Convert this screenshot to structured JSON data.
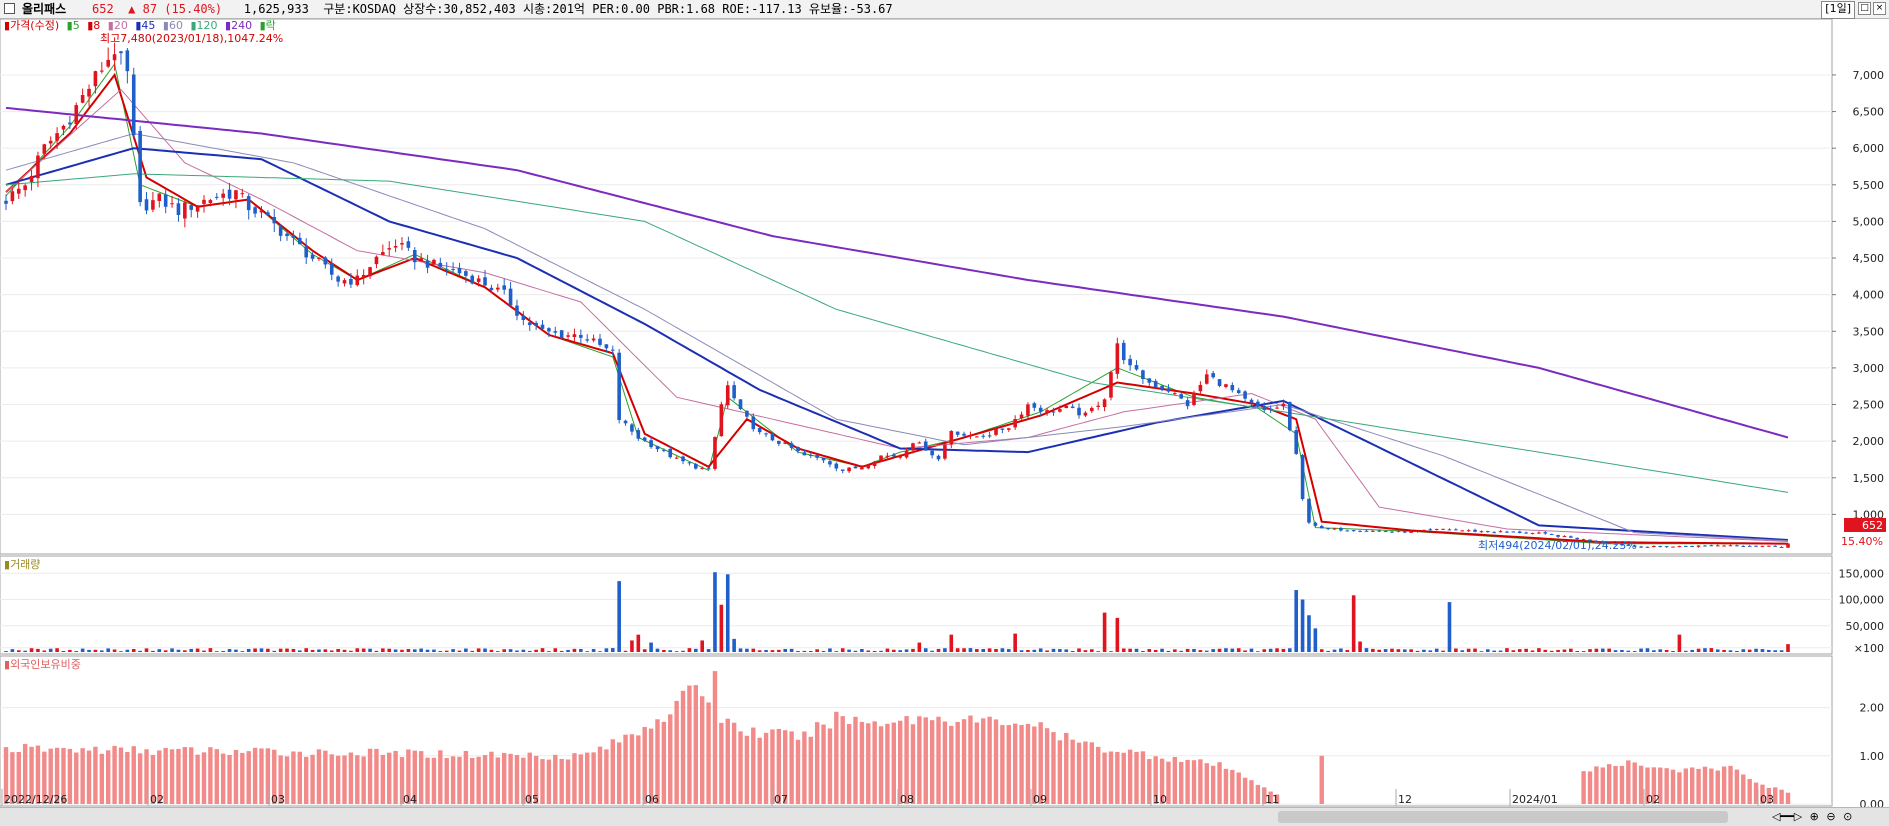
{
  "header": {
    "name": "올리패스",
    "price": "652",
    "arrow": "▲",
    "change": "87",
    "change_pct": "(15.40%)",
    "volume": "1,625,933",
    "info": "구분:KOSDAQ 상장수:30,852,403 시총:201억 PER:0.00 PBR:1.68 ROE:-117.13 유보율:-53.67",
    "period": "[1일]",
    "min_btn": "_",
    "max_btn": "□",
    "close_btn": "×"
  },
  "colors": {
    "up": "#e0141e",
    "down": "#1f5fc9",
    "ma5": "#2ca02c",
    "ma8": "#d40000",
    "ma20": "#c56fa0",
    "ma45": "#1b2fb5",
    "ma60": "#8a8ab8",
    "ma120": "#3aa878",
    "ma240": "#7b2bbf",
    "foreign": "#f28a8a"
  },
  "chart_data": [
    {
      "type": "candlestick",
      "legend_title": "가격(수정)",
      "legend": [
        {
          "name": "5",
          "color": "#2ca02c"
        },
        {
          "name": "8",
          "color": "#d40000"
        },
        {
          "name": "20",
          "color": "#c56fa0"
        },
        {
          "name": "45",
          "color": "#1b2fb5"
        },
        {
          "name": "60",
          "color": "#8a8ab8"
        },
        {
          "name": "120",
          "color": "#3aa878"
        },
        {
          "name": "240",
          "color": "#7b2bbf"
        },
        {
          "name": "락",
          "color": "#2ca02c"
        }
      ],
      "ylim": [
        500,
        7600
      ],
      "yticks": [
        "1,000",
        "1,500",
        "2,000",
        "2,500",
        "3,000",
        "3,500",
        "4,000",
        "4,500",
        "5,000",
        "5,500",
        "6,000",
        "6,500",
        "7,000"
      ],
      "x_labels": [
        "2022/12/26",
        "02",
        "03",
        "04",
        "05",
        "06",
        "07",
        "08",
        "09",
        "10",
        "11",
        "12",
        "2024/01",
        "02",
        "03"
      ],
      "annotations": {
        "high": "최고7,480(2023/01/18),1047.24%",
        "low": "최저494(2024/02/01),24.23%",
        "last_price": "652",
        "last_pct": "15.40%"
      },
      "path_points": [
        [
          0,
          5300
        ],
        [
          3,
          5500
        ],
        [
          6,
          6000
        ],
        [
          9,
          6300
        ],
        [
          12,
          6700
        ],
        [
          15,
          7100
        ],
        [
          17,
          7350
        ],
        [
          19,
          7000
        ],
        [
          20,
          6100
        ],
        [
          21,
          5200
        ],
        [
          24,
          5300
        ],
        [
          27,
          5150
        ],
        [
          30,
          5250
        ],
        [
          33,
          5350
        ],
        [
          36,
          5400
        ],
        [
          38,
          5200
        ],
        [
          40,
          5100
        ],
        [
          44,
          4800
        ],
        [
          48,
          4500
        ],
        [
          52,
          4200
        ],
        [
          55,
          4200
        ],
        [
          58,
          4500
        ],
        [
          61,
          4700
        ],
        [
          64,
          4500
        ],
        [
          67,
          4400
        ],
        [
          71,
          4300
        ],
        [
          75,
          4150
        ],
        [
          78,
          4000
        ],
        [
          81,
          3650
        ],
        [
          84,
          3500
        ],
        [
          87,
          3450
        ],
        [
          90,
          3450
        ],
        [
          93,
          3300
        ],
        [
          95,
          3200
        ],
        [
          96,
          2300
        ],
        [
          99,
          2050
        ],
        [
          102,
          1900
        ],
        [
          105,
          1750
        ],
        [
          108,
          1650
        ],
        [
          110,
          1600
        ],
        [
          112,
          2500
        ],
        [
          113,
          2750
        ],
        [
          115,
          2400
        ],
        [
          118,
          2100
        ],
        [
          122,
          1950
        ],
        [
          125,
          1800
        ],
        [
          128,
          1750
        ],
        [
          131,
          1600
        ],
        [
          134,
          1650
        ],
        [
          137,
          1800
        ],
        [
          140,
          1800
        ],
        [
          142,
          2000
        ],
        [
          144,
          1900
        ],
        [
          146,
          1750
        ],
        [
          148,
          2150
        ],
        [
          151,
          2050
        ],
        [
          154,
          2100
        ],
        [
          157,
          2200
        ],
        [
          160,
          2500
        ],
        [
          163,
          2400
        ],
        [
          166,
          2450
        ],
        [
          169,
          2350
        ],
        [
          172,
          2600
        ],
        [
          174,
          3300
        ],
        [
          176,
          3000
        ],
        [
          179,
          2800
        ],
        [
          182,
          2700
        ],
        [
          185,
          2500
        ],
        [
          188,
          2900
        ],
        [
          191,
          2750
        ],
        [
          194,
          2550
        ],
        [
          197,
          2400
        ],
        [
          200,
          2500
        ],
        [
          202,
          1800
        ],
        [
          203,
          1200
        ],
        [
          204,
          900
        ],
        [
          206,
          800
        ],
        [
          210,
          790
        ],
        [
          215,
          770
        ],
        [
          220,
          760
        ],
        [
          225,
          800
        ],
        [
          230,
          770
        ],
        [
          235,
          760
        ],
        [
          240,
          740
        ],
        [
          245,
          680
        ],
        [
          250,
          620
        ],
        [
          255,
          560
        ],
        [
          260,
          560
        ],
        [
          265,
          570
        ],
        [
          270,
          580
        ],
        [
          275,
          570
        ],
        [
          278,
          560
        ],
        [
          279,
          600
        ]
      ],
      "series": [
        {
          "name": "240",
          "color": "#7b2bbf",
          "points": [
            [
              0,
              6550
            ],
            [
              40,
              6200
            ],
            [
              80,
              5700
            ],
            [
              120,
              4800
            ],
            [
              160,
              4200
            ],
            [
              200,
              3700
            ],
            [
              240,
              3000
            ],
            [
              279,
              2050
            ]
          ]
        },
        {
          "name": "120",
          "color": "#3aa878",
          "points": [
            [
              0,
              5500
            ],
            [
              20,
              5650
            ],
            [
              60,
              5550
            ],
            [
              100,
              5000
            ],
            [
              130,
              3800
            ],
            [
              170,
              2800
            ],
            [
              200,
              2400
            ],
            [
              240,
              1850
            ],
            [
              279,
              1300
            ]
          ]
        },
        {
          "name": "60",
          "color": "#8a8ab8",
          "points": [
            [
              0,
              5700
            ],
            [
              20,
              6200
            ],
            [
              45,
              5800
            ],
            [
              75,
              4900
            ],
            [
              100,
              3800
            ],
            [
              130,
              2300
            ],
            [
              150,
              1950
            ],
            [
              175,
              2200
            ],
            [
              200,
              2500
            ],
            [
              225,
              1800
            ],
            [
              255,
              750
            ],
            [
              279,
              640
            ]
          ]
        },
        {
          "name": "45",
          "color": "#1b2fb5",
          "points": [
            [
              0,
              5500
            ],
            [
              20,
              6000
            ],
            [
              40,
              5850
            ],
            [
              60,
              5000
            ],
            [
              80,
              4500
            ],
            [
              100,
              3600
            ],
            [
              118,
              2700
            ],
            [
              140,
              1900
            ],
            [
              160,
              1850
            ],
            [
              180,
              2250
            ],
            [
              200,
              2550
            ],
            [
              220,
              1700
            ],
            [
              240,
              850
            ],
            [
              279,
              650
            ]
          ]
        },
        {
          "name": "20",
          "color": "#c56fa0",
          "points": [
            [
              0,
              5400
            ],
            [
              18,
              6800
            ],
            [
              28,
              5800
            ],
            [
              40,
              5300
            ],
            [
              55,
              4600
            ],
            [
              75,
              4300
            ],
            [
              90,
              3900
            ],
            [
              105,
              2600
            ],
            [
              120,
              2300
            ],
            [
              140,
              1900
            ],
            [
              160,
              2050
            ],
            [
              175,
              2400
            ],
            [
              195,
              2650
            ],
            [
              205,
              2300
            ],
            [
              215,
              1100
            ],
            [
              235,
              800
            ],
            [
              279,
              630
            ]
          ]
        },
        {
          "name": "8",
          "color": "#d40000",
          "points": [
            [
              0,
              5400
            ],
            [
              10,
              6200
            ],
            [
              17,
              7000
            ],
            [
              22,
              5600
            ],
            [
              30,
              5200
            ],
            [
              38,
              5300
            ],
            [
              48,
              4600
            ],
            [
              55,
              4200
            ],
            [
              64,
              4500
            ],
            [
              75,
              4100
            ],
            [
              85,
              3450
            ],
            [
              95,
              3200
            ],
            [
              100,
              2100
            ],
            [
              110,
              1650
            ],
            [
              116,
              2300
            ],
            [
              124,
              1900
            ],
            [
              134,
              1650
            ],
            [
              140,
              1800
            ],
            [
              150,
              2050
            ],
            [
              162,
              2350
            ],
            [
              174,
              2800
            ],
            [
              186,
              2650
            ],
            [
              196,
              2500
            ],
            [
              202,
              2300
            ],
            [
              206,
              900
            ],
            [
              220,
              780
            ],
            [
              250,
              620
            ],
            [
              279,
              600
            ]
          ]
        },
        {
          "name": "5",
          "color": "#2ca02c",
          "points": [
            [
              0,
              5350
            ],
            [
              10,
              6300
            ],
            [
              17,
              7150
            ],
            [
              21,
              5500
            ],
            [
              30,
              5200
            ],
            [
              38,
              5300
            ],
            [
              48,
              4550
            ],
            [
              55,
              4200
            ],
            [
              64,
              4550
            ],
            [
              75,
              4100
            ],
            [
              85,
              3450
            ],
            [
              95,
              3150
            ],
            [
              99,
              2050
            ],
            [
              110,
              1600
            ],
            [
              113,
              2600
            ],
            [
              124,
              1850
            ],
            [
              134,
              1650
            ],
            [
              140,
              1850
            ],
            [
              150,
              2050
            ],
            [
              162,
              2400
            ],
            [
              174,
              3000
            ],
            [
              186,
              2600
            ],
            [
              196,
              2450
            ],
            [
              202,
              2100
            ],
            [
              205,
              820
            ],
            [
              220,
              770
            ],
            [
              250,
              600
            ],
            [
              279,
              600
            ]
          ]
        }
      ]
    },
    {
      "type": "bar",
      "title": "거래량",
      "ylim": [
        0,
        160000
      ],
      "yticks": [
        "×100",
        "50,000",
        "100,000",
        "150,000"
      ],
      "spikes": [
        {
          "x": 96,
          "value": 135000,
          "dir": "down"
        },
        {
          "x": 98,
          "value": 22000,
          "dir": "up"
        },
        {
          "x": 99,
          "value": 33000,
          "dir": "up"
        },
        {
          "x": 101,
          "value": 18000,
          "dir": "down"
        },
        {
          "x": 109,
          "value": 22000,
          "dir": "up"
        },
        {
          "x": 111,
          "value": 152000,
          "dir": "down"
        },
        {
          "x": 112,
          "value": 90000,
          "dir": "up"
        },
        {
          "x": 113,
          "value": 148000,
          "dir": "down"
        },
        {
          "x": 114,
          "value": 25000,
          "dir": "down"
        },
        {
          "x": 143,
          "value": 18000,
          "dir": "up"
        },
        {
          "x": 148,
          "value": 33000,
          "dir": "up"
        },
        {
          "x": 158,
          "value": 35000,
          "dir": "up"
        },
        {
          "x": 172,
          "value": 75000,
          "dir": "up"
        },
        {
          "x": 174,
          "value": 65000,
          "dir": "up"
        },
        {
          "x": 202,
          "value": 118000,
          "dir": "down"
        },
        {
          "x": 203,
          "value": 100000,
          "dir": "down"
        },
        {
          "x": 204,
          "value": 70000,
          "dir": "down"
        },
        {
          "x": 205,
          "value": 45000,
          "dir": "down"
        },
        {
          "x": 211,
          "value": 108000,
          "dir": "up"
        },
        {
          "x": 212,
          "value": 20000,
          "dir": "up"
        },
        {
          "x": 226,
          "value": 95000,
          "dir": "down"
        },
        {
          "x": 262,
          "value": 33000,
          "dir": "up"
        },
        {
          "x": 279,
          "value": 15000,
          "dir": "up"
        }
      ]
    },
    {
      "type": "bar",
      "title": "외국인보유비중",
      "ylim": [
        0,
        2.8
      ],
      "yticks": [
        "0.00",
        "1.00",
        "2.00"
      ],
      "profile": [
        [
          0,
          1.15
        ],
        [
          30,
          1.1
        ],
        [
          60,
          1.05
        ],
        [
          90,
          1.0
        ],
        [
          96,
          1.3
        ],
        [
          105,
          2.0
        ],
        [
          108,
          2.5
        ],
        [
          110,
          2.2
        ],
        [
          111,
          2.6
        ],
        [
          112,
          1.8
        ],
        [
          116,
          1.5
        ],
        [
          125,
          1.4
        ],
        [
          130,
          1.8
        ],
        [
          135,
          1.7
        ],
        [
          145,
          1.8
        ],
        [
          155,
          1.7
        ],
        [
          160,
          1.7
        ],
        [
          165,
          1.4
        ],
        [
          170,
          1.2
        ],
        [
          180,
          1.0
        ],
        [
          190,
          0.8
        ],
        [
          195,
          0.5
        ],
        [
          199,
          0.2
        ],
        [
          200,
          0.0
        ],
        [
          204,
          0.0
        ],
        [
          205,
          0.0
        ],
        [
          212,
          0.0
        ],
        [
          240,
          0.0
        ],
        [
          246,
          0.0
        ],
        [
          247,
          0.7
        ],
        [
          255,
          0.85
        ],
        [
          262,
          0.7
        ],
        [
          270,
          0.75
        ],
        [
          275,
          0.4
        ],
        [
          279,
          0.25
        ]
      ],
      "extra_bars": [
        {
          "x": 206,
          "value": 1.0
        }
      ]
    }
  ]
}
